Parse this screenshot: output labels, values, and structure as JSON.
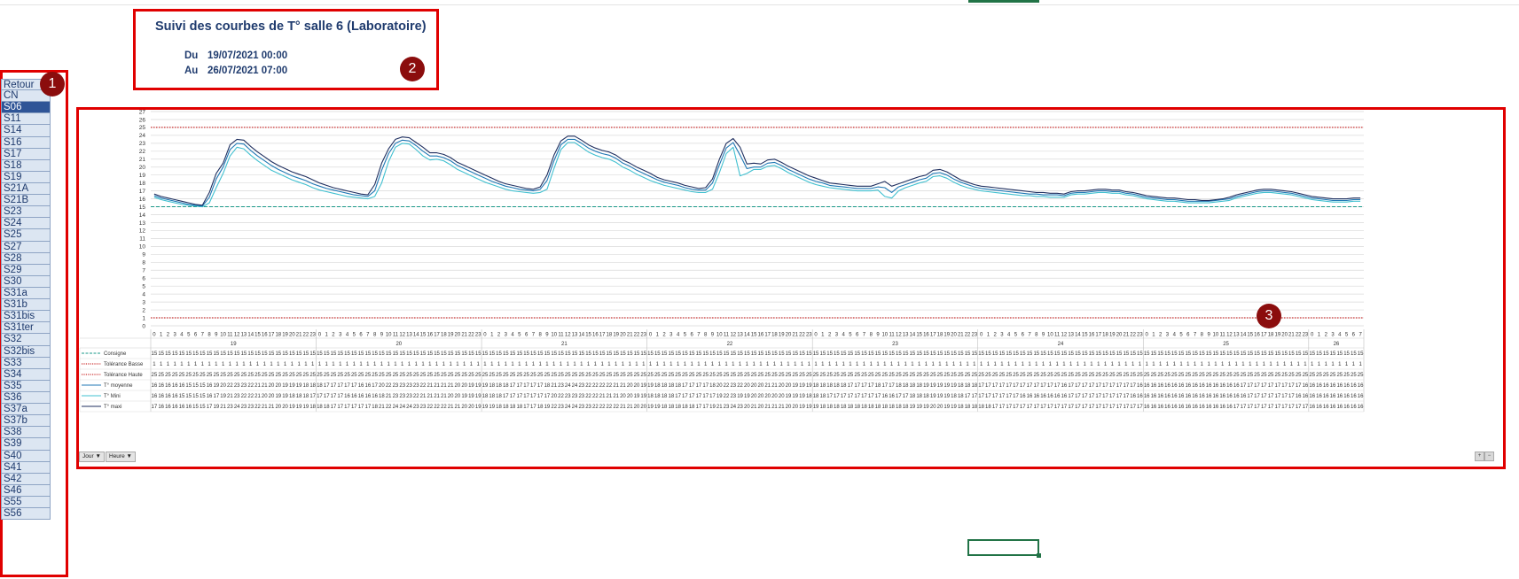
{
  "header": {
    "title": "Suivi des courbes de T° salle 6 (Laboratoire)",
    "from_label": "Du",
    "from_value": "19/07/2021 00:00",
    "to_label": "Au",
    "to_value": "26/07/2021 07:00"
  },
  "badges": {
    "b1": "1",
    "b2": "2",
    "b3": "3"
  },
  "sites": [
    "Retour",
    "CN",
    "S06",
    "S11",
    "S14",
    "S16",
    "S17",
    "S18",
    "S19",
    "S21A",
    "S21B",
    "S23",
    "S24",
    "S25",
    "S27",
    "S28",
    "S29",
    "S30",
    "S31a",
    "S31b",
    "S31bis",
    "S31ter",
    "S32",
    "S32bis",
    "S33",
    "S34",
    "S35",
    "S36",
    "S37a",
    "S37b",
    "S38",
    "S39",
    "S40",
    "S41",
    "S42",
    "S46",
    "S55",
    "S56"
  ],
  "active_site": "S06",
  "colors": {
    "frame": "#e00000",
    "badge": "#8b0d0d",
    "consigne": "#1a9a8a",
    "tolerance": "#c00000",
    "moyenne": "#1f77b4",
    "mini": "#40c0d0",
    "maxi": "#1f2f5f"
  },
  "filters": {
    "day_button": "Jour ▼",
    "hour_button": "Heure ▼"
  },
  "chart_data": {
    "type": "line",
    "ylim": [
      0,
      27
    ],
    "yticks": [
      0,
      1,
      2,
      3,
      4,
      5,
      6,
      7,
      8,
      9,
      10,
      11,
      12,
      13,
      14,
      15,
      16,
      17,
      18,
      19,
      20,
      21,
      22,
      23,
      24,
      25,
      26,
      27
    ],
    "days": [
      "19",
      "20",
      "21",
      "22",
      "23",
      "24",
      "25",
      "26"
    ],
    "hours_per_day": 24,
    "last_day_hours": 8,
    "x_note": "x = hour index from 19/07/2021 00:00 to 26/07/2021 07:00",
    "series": [
      {
        "name": "Consigne",
        "style": "dashed",
        "color": "#1a9a8a",
        "constant": 15
      },
      {
        "name": "Tolérance Basse",
        "style": "dotted",
        "color": "#c00000",
        "constant": 1
      },
      {
        "name": "Tolérance Haute",
        "style": "dotted",
        "color": "#c00000",
        "constant": 25
      },
      {
        "name": "T° moyenne",
        "style": "solid",
        "color": "#1f77b4"
      },
      {
        "name": "T° Mini",
        "style": "solid",
        "color": "#40c0d0"
      },
      {
        "name": "T° maxi",
        "style": "solid",
        "color": "#1f2f5f"
      }
    ],
    "maxi": [
      16.6,
      16.3,
      16.1,
      15.9,
      15.7,
      15.5,
      15.3,
      15.2,
      16.8,
      19.2,
      20.5,
      22.8,
      23.5,
      23.4,
      22.6,
      21.9,
      21.3,
      20.7,
      20.2,
      19.8,
      19.4,
      19.1,
      18.8,
      18.4,
      18.0,
      17.7,
      17.4,
      17.2,
      17.0,
      16.8,
      16.6,
      16.5,
      17.8,
      20.5,
      22.3,
      23.5,
      23.8,
      23.7,
      23.1,
      22.5,
      21.8,
      21.8,
      21.6,
      21.2,
      20.6,
      20.2,
      19.8,
      19.4,
      19.0,
      18.6,
      18.2,
      17.9,
      17.7,
      17.5,
      17.3,
      17.2,
      17.5,
      19.0,
      21.5,
      23.3,
      23.9,
      23.9,
      23.4,
      22.8,
      22.4,
      22.1,
      21.9,
      21.5,
      20.9,
      20.5,
      20.0,
      19.6,
      19.2,
      18.7,
      18.4,
      18.2,
      18.0,
      17.7,
      17.5,
      17.3,
      17.4,
      18.5,
      21.0,
      23.0,
      23.6,
      22.5,
      20.4,
      20.5,
      20.4,
      20.9,
      21.0,
      20.6,
      20.1,
      19.7,
      19.3,
      18.9,
      18.6,
      18.3,
      18.0,
      17.9,
      17.8,
      17.7,
      17.6,
      17.6,
      17.6,
      17.9,
      18.2,
      17.6,
      17.9,
      18.2,
      18.5,
      18.8,
      19.0,
      19.6,
      19.7,
      19.4,
      18.9,
      18.4,
      18.1,
      17.8,
      17.6,
      17.5,
      17.4,
      17.3,
      17.2,
      17.1,
      17.0,
      16.9,
      16.8,
      16.8,
      16.7,
      16.7,
      16.6,
      16.9,
      17.0,
      17.0,
      17.1,
      17.2,
      17.2,
      17.1,
      17.1,
      16.9,
      16.8,
      16.6,
      16.4,
      16.3,
      16.2,
      16.1,
      16.1,
      16.0,
      15.9,
      15.9,
      15.8,
      15.8,
      15.9,
      16.0,
      16.2,
      16.5,
      16.7,
      16.9,
      17.1,
      17.2,
      17.2,
      17.1,
      17.0,
      16.9,
      16.7,
      16.5,
      16.3,
      16.2,
      16.1,
      16.0,
      16.0,
      16.0,
      16.1,
      16.1
    ],
    "moyenne": [
      16.4,
      16.1,
      15.9,
      15.7,
      15.5,
      15.3,
      15.2,
      15.1,
      16.2,
      18.5,
      20.0,
      22.2,
      23.0,
      22.9,
      22.1,
      21.4,
      20.8,
      20.2,
      19.7,
      19.3,
      18.9,
      18.6,
      18.3,
      17.9,
      17.6,
      17.3,
      17.1,
      16.9,
      16.7,
      16.5,
      16.4,
      16.3,
      17.0,
      19.6,
      21.7,
      23.0,
      23.4,
      23.3,
      22.7,
      22.0,
      21.4,
      21.4,
      21.2,
      20.8,
      20.2,
      19.8,
      19.4,
      19.0,
      18.6,
      18.2,
      17.9,
      17.6,
      17.4,
      17.2,
      17.1,
      17.0,
      17.2,
      18.3,
      20.8,
      22.8,
      23.5,
      23.5,
      23.0,
      22.4,
      22.0,
      21.7,
      21.5,
      21.1,
      20.5,
      20.1,
      19.6,
      19.2,
      18.8,
      18.4,
      18.1,
      17.9,
      17.7,
      17.4,
      17.2,
      17.1,
      17.1,
      18.0,
      20.3,
      22.4,
      23.1,
      21.5,
      19.8,
      20.0,
      20.0,
      20.5,
      20.6,
      20.2,
      19.7,
      19.3,
      18.9,
      18.5,
      18.2,
      18.0,
      17.7,
      17.6,
      17.5,
      17.4,
      17.3,
      17.3,
      17.3,
      17.5,
      17.4,
      16.8,
      17.5,
      17.8,
      18.1,
      18.4,
      18.6,
      19.2,
      19.3,
      19.0,
      18.5,
      18.1,
      17.8,
      17.5,
      17.3,
      17.2,
      17.1,
      17.0,
      16.9,
      16.8,
      16.7,
      16.6,
      16.6,
      16.5,
      16.5,
      16.5,
      16.4,
      16.7,
      16.8,
      16.8,
      16.9,
      17.0,
      17.0,
      16.9,
      16.9,
      16.7,
      16.6,
      16.4,
      16.2,
      16.1,
      16.0,
      15.9,
      15.9,
      15.8,
      15.7,
      15.7,
      15.7,
      15.7,
      15.8,
      15.9,
      16.0,
      16.3,
      16.5,
      16.7,
      16.9,
      17.0,
      17.0,
      16.9,
      16.8,
      16.7,
      16.5,
      16.3,
      16.1,
      16.0,
      15.9,
      15.8,
      15.8,
      15.8,
      15.9,
      15.9
    ],
    "mini": [
      16.2,
      15.9,
      15.7,
      15.5,
      15.3,
      15.2,
      15.1,
      15.0,
      15.5,
      17.4,
      19.2,
      21.4,
      22.5,
      22.3,
      21.5,
      20.8,
      20.2,
      19.6,
      19.2,
      18.8,
      18.4,
      18.1,
      17.8,
      17.4,
      17.1,
      16.9,
      16.7,
      16.5,
      16.3,
      16.2,
      16.1,
      16.0,
      16.3,
      18.0,
      20.7,
      22.5,
      23.0,
      22.9,
      22.2,
      21.4,
      20.9,
      21.0,
      20.8,
      20.3,
      19.7,
      19.3,
      18.9,
      18.5,
      18.1,
      17.8,
      17.5,
      17.2,
      17.0,
      16.9,
      16.8,
      16.7,
      16.8,
      17.2,
      19.8,
      22.2,
      23.1,
      23.1,
      22.5,
      21.9,
      21.5,
      21.2,
      21.0,
      20.6,
      20.0,
      19.6,
      19.1,
      18.7,
      18.3,
      18.0,
      17.7,
      17.5,
      17.3,
      17.1,
      16.9,
      16.8,
      16.8,
      17.2,
      19.3,
      21.7,
      22.5,
      18.9,
      19.2,
      19.7,
      19.7,
      20.1,
      20.2,
      19.8,
      19.3,
      18.9,
      18.5,
      18.1,
      17.8,
      17.6,
      17.4,
      17.3,
      17.2,
      17.1,
      17.0,
      17.0,
      17.0,
      17.1,
      16.3,
      16.1,
      17.0,
      17.4,
      17.7,
      18.0,
      18.2,
      18.8,
      18.9,
      18.6,
      18.1,
      17.7,
      17.4,
      17.2,
      17.0,
      16.9,
      16.8,
      16.7,
      16.6,
      16.5,
      16.4,
      16.4,
      16.3,
      16.3,
      16.2,
      16.2,
      16.2,
      16.5,
      16.6,
      16.6,
      16.7,
      16.8,
      16.8,
      16.7,
      16.7,
      16.5,
      16.4,
      16.2,
      16.0,
      15.9,
      15.8,
      15.7,
      15.7,
      15.6,
      15.5,
      15.5,
      15.5,
      15.5,
      15.6,
      15.7,
      15.8,
      16.1,
      16.3,
      16.5,
      16.7,
      16.8,
      16.8,
      16.7,
      16.6,
      16.5,
      16.3,
      16.1,
      15.9,
      15.8,
      15.7,
      15.6,
      15.6,
      15.6,
      15.7,
      15.7
    ],
    "table_rows": [
      {
        "label": "Consigne",
        "style": "dashed",
        "color": "#1a9a8a",
        "values": "15"
      },
      {
        "label": "Tolérance Basse",
        "style": "dotted",
        "color": "#c00000",
        "values": "1"
      },
      {
        "label": "Tolérance Haute",
        "style": "dotted",
        "color": "#c00000",
        "values": "25"
      },
      {
        "label": "T° moyenne",
        "style": "solid",
        "color": "#1f77b4",
        "source": "moyenne"
      },
      {
        "label": "T° Mini",
        "style": "solid",
        "color": "#40c0d0",
        "source": "mini"
      },
      {
        "label": "T° maxi",
        "style": "solid",
        "color": "#1f2f5f",
        "source": "maxi"
      }
    ]
  }
}
